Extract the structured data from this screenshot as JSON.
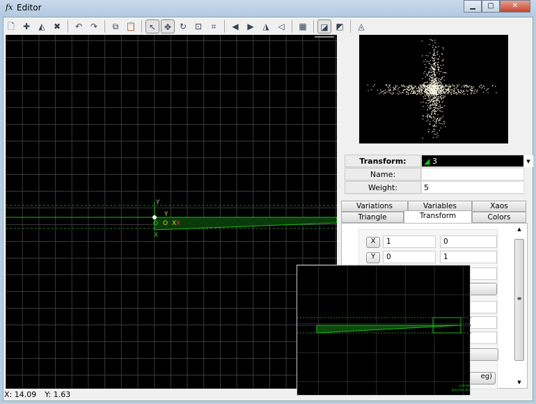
{
  "window": {
    "title": "Editor",
    "icon": "fx-icon",
    "controls": [
      "minimize",
      "maximize",
      "close"
    ]
  },
  "toolbar": {
    "items": [
      {
        "icon": "new-icon",
        "glyph": "🗋"
      },
      {
        "icon": "add-transform-icon",
        "glyph": "✚"
      },
      {
        "icon": "duplicate-icon",
        "glyph": "◭"
      },
      {
        "icon": "delete-icon",
        "glyph": "✖"
      },
      "sep",
      {
        "icon": "undo-icon",
        "glyph": "↶"
      },
      {
        "icon": "redo-icon",
        "glyph": "↷"
      },
      "sep",
      {
        "icon": "copy-icon",
        "glyph": "⧉"
      },
      {
        "icon": "paste-icon",
        "glyph": "📋"
      },
      "sep",
      {
        "icon": "select-icon",
        "glyph": "↖",
        "active": true
      },
      {
        "icon": "move-icon",
        "glyph": "✥",
        "active": true
      },
      {
        "icon": "rotate-icon",
        "glyph": "↻"
      },
      {
        "icon": "scale-icon",
        "glyph": "⊡"
      },
      {
        "icon": "zoom-fit-icon",
        "glyph": "⌗"
      },
      "sep",
      {
        "icon": "rotate-left-icon",
        "glyph": "◀"
      },
      {
        "icon": "rotate-right-icon",
        "glyph": "▶"
      },
      {
        "icon": "flip-horizontal-icon",
        "glyph": "◮"
      },
      {
        "icon": "flip-vertical-icon",
        "glyph": "◁"
      },
      "sep",
      {
        "icon": "grid-icon",
        "glyph": "▦"
      },
      "sep",
      {
        "icon": "post-transform-icon",
        "glyph": "◪",
        "active": true
      },
      {
        "icon": "final-transform-icon",
        "glyph": "◩"
      },
      "sep",
      {
        "icon": "add-final-icon",
        "glyph": "◬"
      }
    ]
  },
  "status": {
    "x": "X: 14.09",
    "y": "Y: 1.63"
  },
  "props": {
    "transform_label": "Transform:",
    "transform_value": "3",
    "name_label": "Name:",
    "name_value": "",
    "weight_label": "Weight:",
    "weight_value": "5"
  },
  "tabs": {
    "row1": [
      "Variations",
      "Variables",
      "Xaos"
    ],
    "row2": [
      "Triangle",
      "Transform",
      "Colors"
    ],
    "active": "Transform"
  },
  "transform": {
    "x_label": "X",
    "x": [
      "1",
      "0"
    ],
    "y_label": "Y",
    "y": [
      "0",
      "1"
    ],
    "partial_button": "eg)"
  },
  "canvas": {
    "labels": {
      "y": "Y",
      "x": "X",
      "o": "O",
      "xx": "XX"
    }
  },
  "colors": {
    "triangle": "#18c018",
    "grid": "#3a3a3a",
    "background": "#000000"
  }
}
